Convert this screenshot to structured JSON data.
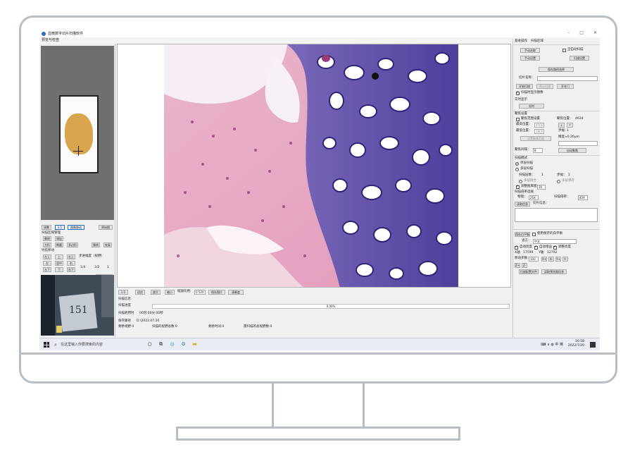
{
  "app": {
    "title": "显微数字切片扫描软件",
    "window_buttons": [
      "–",
      "□",
      "✕"
    ],
    "menu": "预览与检查"
  },
  "left": {
    "preview_buttons": [
      "调整",
      "1:1",
      "图像移动",
      "原始图"
    ],
    "region_label": "扫描区域管理",
    "region_buttons": [
      "删除",
      "增加",
      "方形",
      "椭圆",
      "多边形",
      "撤销",
      "恢复"
    ],
    "nav_label": "导航移动",
    "nav_buttons": [
      "左上",
      "上",
      "右上",
      "左",
      "居中",
      "右",
      "左下",
      "下",
      "右下"
    ],
    "step_label": "步进幅度（视野）",
    "step_values": [
      "1/4",
      "1/2",
      "1"
    ],
    "rotate_button": "旋转90度",
    "camera_text": "151"
  },
  "viewer": {
    "toolbar": [
      "1:1",
      "适应",
      "放大",
      "缩小"
    ],
    "zoom_label": "缩放比例:",
    "zoom_value": "0.52X",
    "toolbar_extra": [
      "保存图片",
      "清晰度"
    ]
  },
  "status": {
    "scan_info_label": "扫描信息",
    "progress_label": "扫描进度",
    "progress_value": "0.00%",
    "progress_fraction": 0,
    "time_label": "扫描耗用时",
    "time_value": "00时:00分:00秒",
    "save_path_label": "保存路径",
    "save_path_value": "D:\\2022.07.20",
    "remaining_fields": "剩余视野:0",
    "scanned_fields": "扫描的视野总数:0",
    "remaining_time": "剩余时间:0",
    "scanned_area": "需扫描的总视野数:0"
  },
  "right": {
    "tabs": [
      "基本操作",
      "扫描区域"
    ],
    "manual_select": "手动选取",
    "auto_scan": "全自动扫描",
    "manual_setup": "手动设置",
    "scan_setup": "扫描设置",
    "save_path_button": "保存路径选择",
    "slice_name_label": "切片名称：",
    "slice_name_value": "",
    "start_scan": "开始扫描",
    "stop_scan": "停止扫描",
    "open_door": "开仓门",
    "show_image_on_scan": "扫描时显示图像",
    "realtime_label": "实时显示",
    "realtime_button": "实时",
    "focus_settings": "聚焦设置",
    "focus_position_label": "聚焦位置：",
    "focus_position_value": "4634",
    "focus_area_check": "聚焦范围设置",
    "max_pos_label": "最高位置：",
    "max_pos_value": "4500",
    "min_pos_label": "最低位置：",
    "min_pos_value": "3800",
    "step_label": "步幅：",
    "step_value": "1",
    "down_up": [
      "↓",
      "↑"
    ],
    "setpoint_button": "设置聚焦范围",
    "precision_label": "精度≈0.26μm",
    "focus_interval_label": "聚焦间隔：",
    "focus_interval_value": "8",
    "auto_focus": "自动聚焦",
    "scan_mode_label": "扫描模式",
    "single_layer": "单层扫描",
    "multi_layer": "多层扫描",
    "scan_layers_label": "扫描层数：",
    "scan_layers_value": "1",
    "step_span_label": "步幅：",
    "step_span_value": "1",
    "multi_merge": "多层融合",
    "multi_save": "多层保存",
    "auto_stitch": "调整图库图：",
    "stitch_value": "30",
    "magnification_label": "扫描倍率选择",
    "objective_label": "物镜：",
    "objective_value": "20X",
    "scan_mag_label": "扫描倍率：",
    "scan_mag_value": "40X",
    "read_info": "读取信息",
    "slide_info_label": "切片信息：",
    "tab_plane": "保存白平衡",
    "use_saved": "使用保存的白平衡",
    "language_label": "语言：",
    "language_value": "中文",
    "auto_bright": "自动亮度",
    "auto_wb": "自动增益",
    "wb_checkbox": "调整亮度",
    "x_label": "X轴",
    "x_value": "17599",
    "y_label": "Y轴",
    "y_value": "12792",
    "move_step_label": "移动步数：",
    "move_step_value": "100",
    "arrows": [
      "X+",
      "X-",
      "Y+",
      "Y-",
      "Z+",
      "Z-"
    ],
    "calib_button": "扫描配置文件",
    "reset_button": "读取预览图信息"
  },
  "taskbar": {
    "search_placeholder": "在这里输入你要搜索的内容",
    "time": "16:58",
    "date": "2022/7/20",
    "tray_text": "中 英"
  },
  "colors": {
    "accent": "#2d6bbf",
    "tissue_pink": "#e5a4c0",
    "cartilage_blue": "#5b4fa8",
    "frame_gray": "#b8bec3"
  }
}
